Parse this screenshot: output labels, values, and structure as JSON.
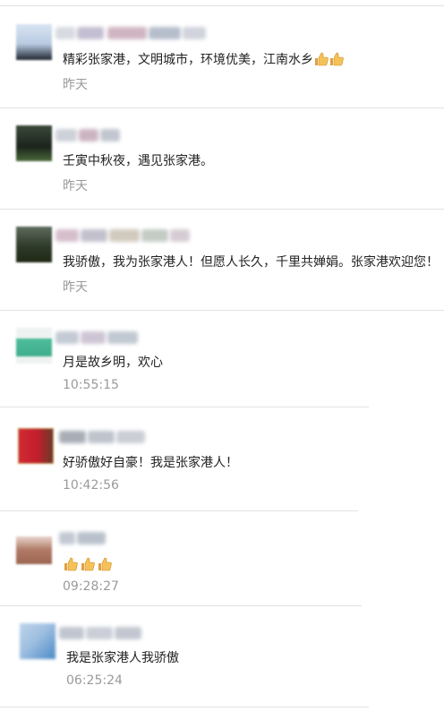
{
  "comments": [
    {
      "text": "精彩张家港，文明城市，环境优美，江南水乡",
      "emoji": [
        "thumbs-up-icon",
        "thumbs-up-icon"
      ],
      "time": "昨天"
    },
    {
      "text": "壬寅中秋夜，遇见张家港。",
      "emoji": [],
      "time": "昨天"
    },
    {
      "text": "我骄傲，我为张家港人！但愿人长久，千里共婵娟。张家港欢迎您！",
      "emoji": [],
      "time": "昨天"
    },
    {
      "text": "月是故乡明，欢心",
      "emoji": [],
      "time": "10:55:15"
    },
    {
      "text": "好骄傲好自豪！我是张家港人！",
      "emoji": [],
      "time": "10:42:56"
    },
    {
      "text": "",
      "emoji": [
        "thumbs-up-icon",
        "thumbs-up-icon",
        "thumbs-up-icon"
      ],
      "time": "09:28:27"
    },
    {
      "text": "我是张家港人我骄傲",
      "emoji": [],
      "time": "06:25:24"
    }
  ]
}
